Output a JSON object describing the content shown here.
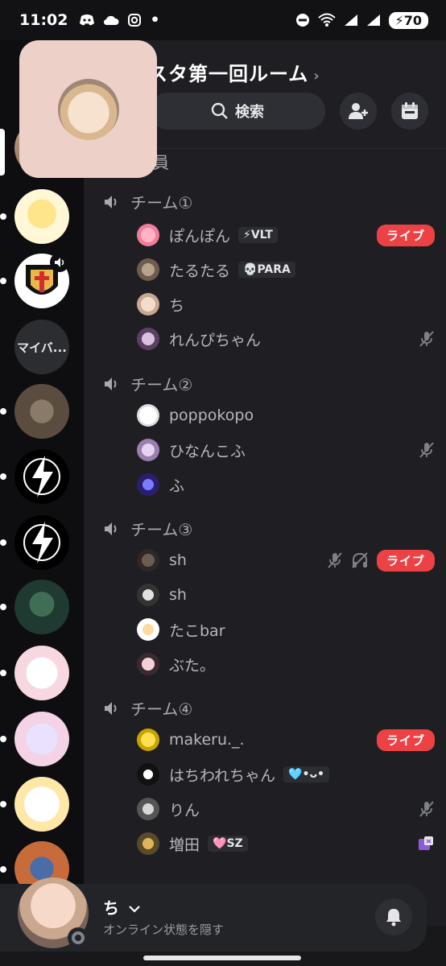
{
  "status_bar": {
    "time": "11:02",
    "battery": "70"
  },
  "server": {
    "name": "スタ第一回ルーム",
    "search_label": "検索"
  },
  "members_header": "員",
  "rail": {
    "text_server_label": "マイバ..."
  },
  "categories": [
    {
      "name": "チーム①",
      "users": [
        {
          "name": "ぽんぽん",
          "tag": "⚡VLT",
          "live": "ライブ"
        },
        {
          "name": "たるたる",
          "tag": "💀PARA"
        },
        {
          "name": "ち"
        },
        {
          "name": "れんぴちゃん",
          "muted": true
        }
      ]
    },
    {
      "name": "チーム②",
      "users": [
        {
          "name": "poppokopo"
        },
        {
          "name": "ひなんこふ",
          "muted": true
        },
        {
          "name": "ふ"
        }
      ]
    },
    {
      "name": "チーム③",
      "users": [
        {
          "name": "sh",
          "muted": true,
          "deafened": true,
          "live": "ライブ"
        },
        {
          "name": "sh"
        },
        {
          "name": "たこbar"
        },
        {
          "name": "ぶた。"
        }
      ]
    },
    {
      "name": "チーム④",
      "users": [
        {
          "name": "makeru._.",
          "live": "ライブ"
        },
        {
          "name": "はちわれちゃん",
          "tag": "🩵•ᴗ•"
        },
        {
          "name": "りん",
          "muted": true
        },
        {
          "name": "増田",
          "tag": "🩷SZ"
        }
      ]
    }
  ],
  "me": {
    "name": "ち",
    "status": "オンライン状態を隠す"
  },
  "colors": {
    "live": "#ed4245",
    "panel": "#1f1f23",
    "rail": "#0e0e10"
  }
}
